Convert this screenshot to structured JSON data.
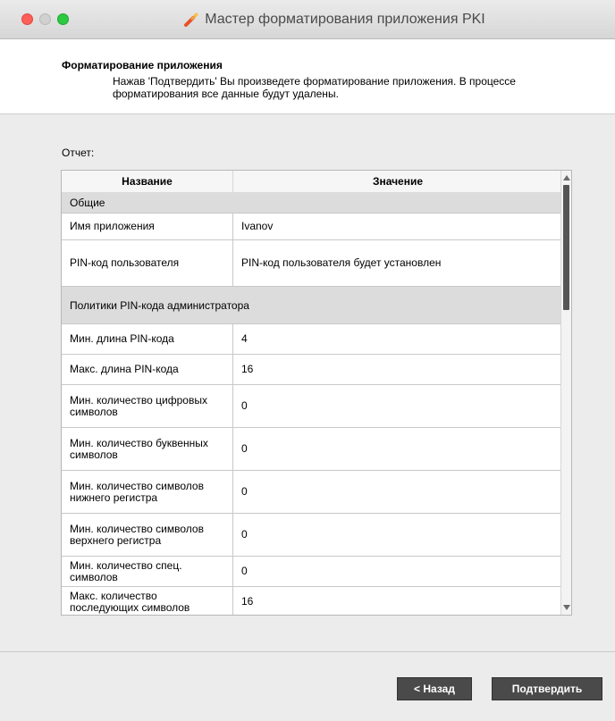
{
  "window": {
    "title": "Мастер форматирования приложения PKI",
    "icon": "wrench-screwdriver-icon"
  },
  "header": {
    "title": "Форматирование приложения",
    "description": "Нажав 'Подтвердить' Вы произведете форматирование приложения. В процессе форматирования все данные будут удалены."
  },
  "report": {
    "label": "Отчет:",
    "columns": {
      "name": "Название",
      "value": "Значение"
    },
    "rows": [
      {
        "type": "section",
        "name": "Общие"
      },
      {
        "type": "row",
        "name": "Имя приложения",
        "value": "Ivanov"
      },
      {
        "type": "row",
        "name": "PIN-код пользователя",
        "value": "PIN-код пользователя будет установлен"
      },
      {
        "type": "section",
        "name": "Политики PIN-кода администратора"
      },
      {
        "type": "row",
        "name": "Мин. длина PIN-кода",
        "value": "4"
      },
      {
        "type": "row",
        "name": "Макс. длина PIN-кода",
        "value": "16"
      },
      {
        "type": "row",
        "name": "Мин. количество цифровых символов",
        "value": "0"
      },
      {
        "type": "row",
        "name": "Мин. количество буквенных символов",
        "value": "0"
      },
      {
        "type": "row",
        "name": "Мин. количество символов нижнего регистра",
        "value": "0"
      },
      {
        "type": "row",
        "name": "Мин. количество символов верхнего регистра",
        "value": "0"
      },
      {
        "type": "row",
        "name": "Мин. количество спец. символов",
        "value": "0"
      },
      {
        "type": "row",
        "name": "Макс. количество последующих символов",
        "value": "16"
      }
    ]
  },
  "buttons": {
    "back": "< Назад",
    "confirm": "Подтвердить"
  },
  "colors": {
    "button_bg": "#4a4a4a",
    "section_bg": "#dcdcdc",
    "close": "#fc5f57",
    "maximize": "#2cc941"
  }
}
